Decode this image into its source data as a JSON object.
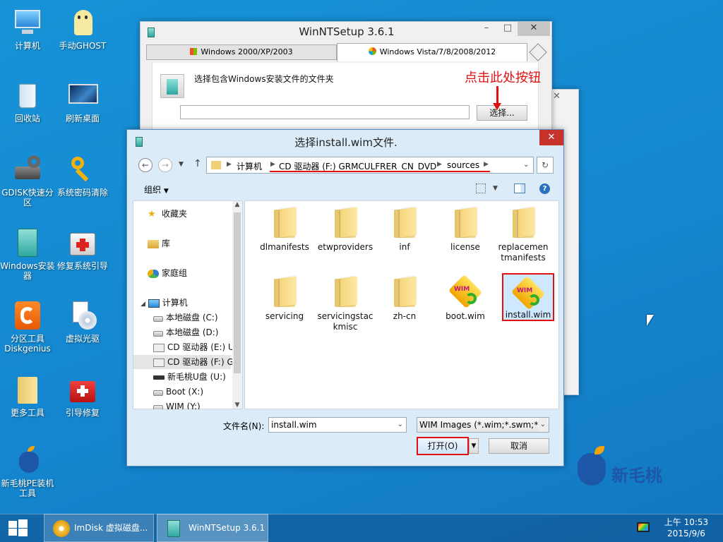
{
  "desktop_icons": [
    {
      "label": "计算机",
      "icon": "computer-icon"
    },
    {
      "label": "手动GHOST",
      "icon": "ghost-icon"
    },
    {
      "label": "回收站",
      "icon": "recycle-bin-icon"
    },
    {
      "label": "刷新桌面",
      "icon": "refresh-desktop-icon"
    },
    {
      "label": "GDISK快速分区",
      "icon": "gdisk-icon"
    },
    {
      "label": "系统密码清除",
      "icon": "key-icon"
    },
    {
      "label": "Windows安装器",
      "icon": "windows-installer-icon"
    },
    {
      "label": "修复系统引导",
      "icon": "first-aid-icon"
    },
    {
      "label": "分区工具Diskgenius",
      "icon": "diskgenius-icon"
    },
    {
      "label": "虚拟光驱",
      "icon": "virtual-drive-icon"
    },
    {
      "label": "更多工具",
      "icon": "folder-icon"
    },
    {
      "label": "引导修复",
      "icon": "toolbox-icon"
    },
    {
      "label": "新毛桃PE装机工具",
      "icon": "peach-icon"
    }
  ],
  "winnt": {
    "title": "WinNTSetup 3.6.1",
    "tab_xp": "Windows 2000/XP/2003",
    "tab_vista": "Windows Vista/7/8/2008/2012",
    "prompt": "选择包含Windows安装文件的文件夹",
    "path_value": "",
    "select_button": "选择...",
    "annotation": "点击此处按钮"
  },
  "dialog": {
    "title": "选择install.wim文件.",
    "breadcrumb": [
      "计算机",
      "CD 驱动器 (F:) GRMCULFRER_CN_DVD",
      "sources"
    ],
    "organize": "组织",
    "nav": {
      "favorites": "收藏夹",
      "library": "库",
      "homegroup": "家庭组",
      "computer": "计算机",
      "drives": [
        "本地磁盘 (C:)",
        "本地磁盘 (D:)",
        "CD 驱动器 (E:) U",
        "CD 驱动器 (F:) G",
        "新毛桃U盘 (U:)",
        "Boot (X:)",
        "WIM (Y:)"
      ]
    },
    "files": [
      {
        "name": "dlmanifests",
        "type": "folder"
      },
      {
        "name": "etwproviders",
        "type": "folder"
      },
      {
        "name": "inf",
        "type": "folder"
      },
      {
        "name": "license",
        "type": "folder"
      },
      {
        "name": "replacementmanifests",
        "type": "folder"
      },
      {
        "name": "servicing",
        "type": "folder"
      },
      {
        "name": "servicingstackmisc",
        "type": "folder"
      },
      {
        "name": "zh-cn",
        "type": "folder"
      },
      {
        "name": "boot.wim",
        "type": "wim"
      },
      {
        "name": "install.wim",
        "type": "wim",
        "selected": true
      }
    ],
    "filename_label": "文件名(N):",
    "filename_value": "install.wim",
    "filter": "WIM Images (*.wim;*.swm;*.e",
    "open_button": "打开(O)",
    "cancel_button": "取消",
    "wim_badge": "WIM"
  },
  "taskbar": {
    "items": [
      "ImDisk 虚拟磁盘...",
      "WinNTSetup 3.6.1"
    ],
    "time": "上午 10:53",
    "date": "2015/9/6"
  },
  "brand": "新毛桃",
  "colors": {
    "accent_red": "#e01010",
    "desktop_blue": "#1486cf"
  }
}
